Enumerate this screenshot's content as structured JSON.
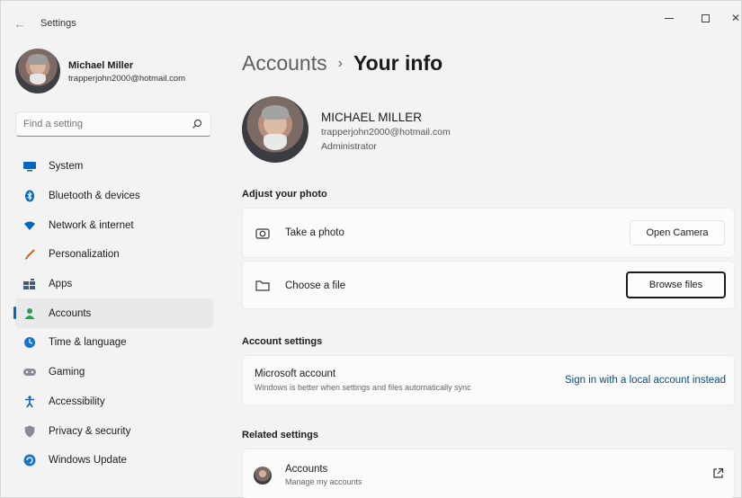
{
  "window": {
    "title": "Settings",
    "back_icon": "←",
    "controls": {
      "close": "✕"
    }
  },
  "profile": {
    "name": "Michael Miller",
    "email": "trapperjohn2000@hotmail.com"
  },
  "search": {
    "placeholder": "Find a setting"
  },
  "nav": {
    "items": [
      {
        "label": "System",
        "icon": "system-icon",
        "color": "#0067c0"
      },
      {
        "label": "Bluetooth & devices",
        "icon": "bluetooth-icon",
        "color": "#0067c0"
      },
      {
        "label": "Network & internet",
        "icon": "wifi-icon",
        "color": "#0067c0"
      },
      {
        "label": "Personalization",
        "icon": "brush-icon",
        "color": "#c46a2a"
      },
      {
        "label": "Apps",
        "icon": "apps-icon",
        "color": "#4a5a7a"
      },
      {
        "label": "Accounts",
        "icon": "person-icon",
        "color": "#2e9a5a",
        "active": true
      },
      {
        "label": "Time & language",
        "icon": "globe-clock-icon",
        "color": "#1a73c9"
      },
      {
        "label": "Gaming",
        "icon": "gamepad-icon",
        "color": "#7a7a8a"
      },
      {
        "label": "Accessibility",
        "icon": "accessibility-icon",
        "color": "#1a5fb4"
      },
      {
        "label": "Privacy & security",
        "icon": "shield-icon",
        "color": "#7a7a8a"
      },
      {
        "label": "Windows Update",
        "icon": "update-icon",
        "color": "#1a73c9"
      }
    ]
  },
  "breadcrumb": {
    "parent": "Accounts",
    "separator": "›",
    "current": "Your info"
  },
  "user": {
    "name": "MICHAEL MILLER",
    "email": "trapperjohn2000@hotmail.com",
    "role": "Administrator"
  },
  "adjust_photo": {
    "header": "Adjust your photo",
    "take_photo": {
      "label": "Take a photo",
      "button": "Open Camera"
    },
    "choose_file": {
      "label": "Choose a file",
      "button": "Browse files"
    }
  },
  "account_settings": {
    "header": "Account settings",
    "microsoft_account": {
      "title": "Microsoft account",
      "description": "Windows is better when settings and files automatically sync",
      "link": "Sign in with a local account instead"
    }
  },
  "related_settings": {
    "header": "Related settings",
    "accounts": {
      "title": "Accounts",
      "description": "Manage my accounts"
    }
  },
  "colors": {
    "accent": "#0067c0",
    "link": "#004e8c",
    "background": "#f3f3f3",
    "card": "#fbfbfb"
  }
}
